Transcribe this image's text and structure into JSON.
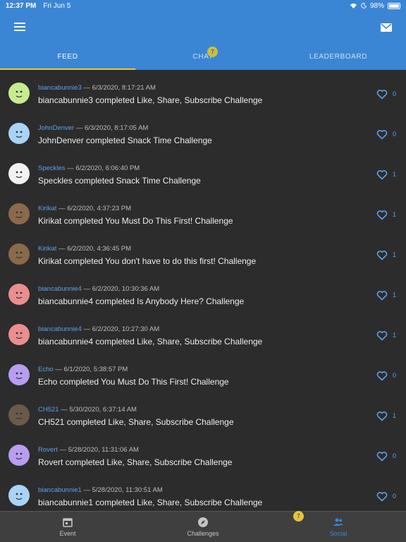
{
  "status": {
    "time": "12:37 PM",
    "date": "Fri Jun 5",
    "battery": "98%",
    "battery_level": 0.98
  },
  "icons": {
    "menu": "hamburger-icon",
    "mail": "mail-icon",
    "like": "heart-outline-icon",
    "wifi": "wifi-icon",
    "battery": "battery-icon",
    "moon": "moon-icon"
  },
  "tabs": [
    {
      "label": "FEED",
      "active": true
    },
    {
      "label": "CHAT",
      "badge": "7"
    },
    {
      "label": "LEADERBOARD"
    }
  ],
  "colors": {
    "primary": "#3b86d4",
    "accent": "#f0c93a",
    "link": "#5aa1ec",
    "background": "#2c2c2c"
  },
  "feed": [
    {
      "user": "biancabunnie3",
      "sep": " — ",
      "time": "6/3/2020, 8:17:21 AM",
      "text": "biancabunnie3 completed Like, Share, Subscribe Challenge",
      "likes": "0",
      "avatar": "green"
    },
    {
      "user": "JohnDenver",
      "sep": " — ",
      "time": "6/3/2020, 8:17:05 AM",
      "text": "JohnDenver completed Snack Time Challenge",
      "likes": "0",
      "avatar": "blue"
    },
    {
      "user": "Speckles",
      "sep": " — ",
      "time": "6/2/2020, 6:06:40 PM",
      "text": "Speckles completed Snack Time Challenge",
      "likes": "1",
      "avatar": "cat"
    },
    {
      "user": "Kirikat",
      "sep": " — ",
      "time": "6/2/2020, 4:37:23 PM",
      "text": "Kirikat completed You Must Do This First! Challenge",
      "likes": "1",
      "avatar": "photo"
    },
    {
      "user": "Kirikat",
      "sep": " — ",
      "time": "6/2/2020, 4:36:45 PM",
      "text": "Kirikat completed You don't have to do this first! Challenge",
      "likes": "1",
      "avatar": "photo"
    },
    {
      "user": "biancabunnie4",
      "sep": " — ",
      "time": "6/2/2020, 10:30:36 AM",
      "text": "biancabunnie4 completed Is Anybody Here? Challenge",
      "likes": "1",
      "avatar": "red"
    },
    {
      "user": "biancabunnie4",
      "sep": " — ",
      "time": "6/2/2020, 10:27:30 AM",
      "text": "biancabunnie4 completed Like, Share, Subscribe Challenge",
      "likes": "1",
      "avatar": "red"
    },
    {
      "user": "Echo",
      "sep": " — ",
      "time": "6/1/2020, 5:38:57 PM",
      "text": "Echo completed You Must Do This First! Challenge",
      "likes": "0",
      "avatar": "purple"
    },
    {
      "user": "CH521",
      "sep": " — ",
      "time": "5/30/2020, 6:37:14 AM",
      "text": "CH521 completed Like, Share, Subscribe Challenge",
      "likes": "1",
      "avatar": "photo2"
    },
    {
      "user": "Rovert",
      "sep": " — ",
      "time": "5/28/2020, 11:31:06 AM",
      "text": "Rovert completed Like, Share, Subscribe Challenge",
      "likes": "0",
      "avatar": "purple"
    },
    {
      "user": "biancabunnie1",
      "sep": " — ",
      "time": "5/28/2020, 11:30:51 AM",
      "text": "biancabunnie1 completed Like, Share, Subscribe Challenge",
      "likes": "0",
      "avatar": "blue"
    }
  ],
  "bottomnav": [
    {
      "label": "Event",
      "icon": "calendar-icon"
    },
    {
      "label": "Challenges",
      "icon": "compass-icon"
    },
    {
      "label": "Social",
      "icon": "people-icon",
      "active": true,
      "badge": "7"
    }
  ]
}
